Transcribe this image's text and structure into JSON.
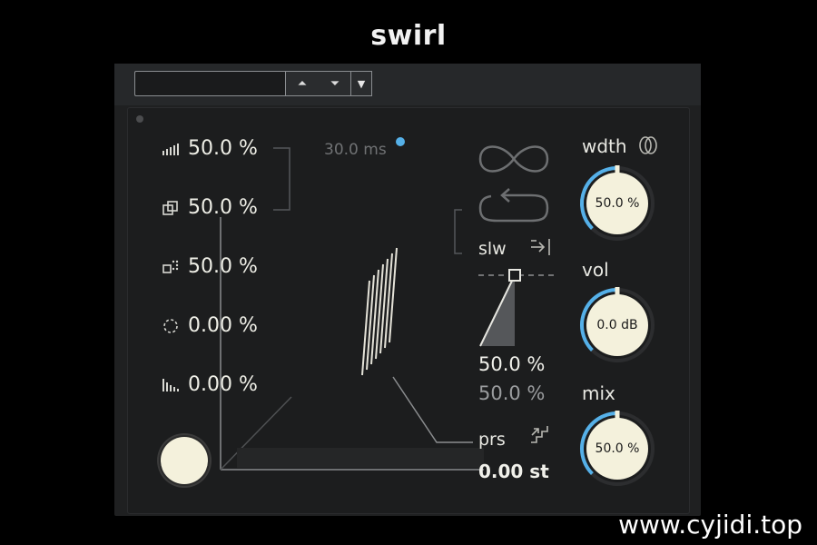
{
  "caption": {
    "title": "swirl",
    "watermark": "www.cyjidi.top"
  },
  "topbar": {
    "preset_value": "",
    "up_arrow": "⏶",
    "down_arrow": "⏷",
    "dropdown_arrow": "▼"
  },
  "params": [
    {
      "icon": "bars-ramp-icon",
      "value": "50.0 %"
    },
    {
      "icon": "stacked-squares-icon",
      "value": "50.0 %"
    },
    {
      "icon": "dotted-squares-icon",
      "value": "50.0 %"
    },
    {
      "icon": "dotted-circle-icon",
      "value": "0.00 %"
    },
    {
      "icon": "bars-decay-icon",
      "value": "0.00 %"
    }
  ],
  "delay": {
    "value": "30.0 ms"
  },
  "modes": {
    "slw_label": "slw",
    "prs_label": "prs",
    "value_primary": "50.0 %",
    "value_secondary": "50.0 %",
    "pitch_value": "0.00 st"
  },
  "knobs": {
    "width": {
      "label": "wdth",
      "value": "50.0 %",
      "level": 0.5
    },
    "volume": {
      "label": "vol",
      "value": "0.0 dB",
      "level": 0.5
    },
    "mix": {
      "label": "mix",
      "value": "50.0 %",
      "level": 0.5
    }
  },
  "colors": {
    "accent_blue": "#55b0e8",
    "knob_face": "#f4f1dc",
    "panel_bg": "#1c1d1e"
  }
}
